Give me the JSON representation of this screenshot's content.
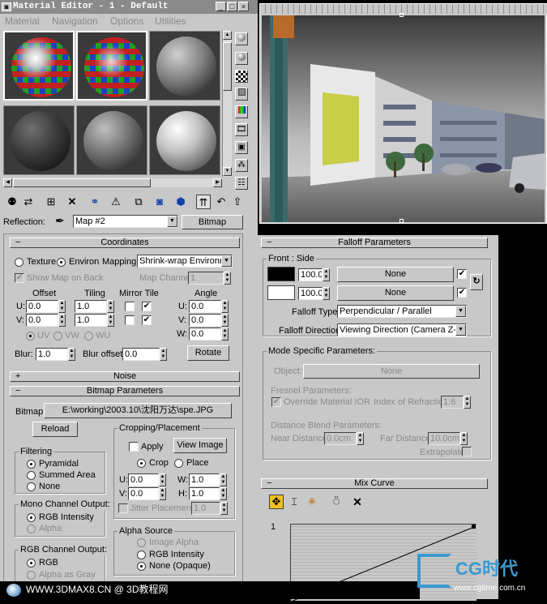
{
  "window": {
    "title": "Material Editor - 1 - Default",
    "title_buttons": [
      "_",
      "□",
      "×"
    ]
  },
  "menu": [
    "Material",
    "Navigation",
    "Options",
    "Utilities"
  ],
  "side_icons": [
    "sphere-icon",
    "sphere-lit-icon",
    "checker-icon",
    "square-icon",
    "gradient-icon",
    "film-icon",
    "monitor-icon",
    "tree-icon",
    "options-icon"
  ],
  "toolbar_icons": [
    "get-material-icon",
    "put-to-scene-icon",
    "assign-icon",
    "delete-icon",
    "make-unique-icon",
    "put-to-library-icon",
    "material-id-icon",
    "show-map-icon",
    "show-end-result-icon",
    "go-to-parent-icon",
    "go-forward-icon",
    "up-icon"
  ],
  "reflection": {
    "label": "Reflection:",
    "map_name": "Map #2",
    "type_button": "Bitmap"
  },
  "coordinates": {
    "title": "Coordinates",
    "texture_label": "Texture",
    "environ_label": "Environ",
    "mapping_label": "Mapping:",
    "mapping_value": "Shrink-wrap Environment",
    "show_map_label": "Show Map on Back",
    "map_channel_label": "Map Channel:",
    "map_channel_value": "1",
    "headers": {
      "offset": "Offset",
      "tiling": "Tiling",
      "mirror_tile": "Mirror Tile",
      "angle": "Angle"
    },
    "u_label": "U:",
    "v_label": "V:",
    "w_label": "W:",
    "u_offset": "0.0",
    "v_offset": "0.0",
    "u_tiling": "1.0",
    "v_tiling": "1.0",
    "u_angle": "0.0",
    "v_angle": "0.0",
    "w_angle": "0.0",
    "uv_label": "UV",
    "vw_label": "VW",
    "wu_label": "WU",
    "blur_label": "Blur:",
    "blur_value": "1.0",
    "blur_offset_label": "Blur offset:",
    "blur_offset_value": "0.0",
    "rotate_button": "Rotate"
  },
  "noise": {
    "title": "Noise"
  },
  "bitmap_params": {
    "title": "Bitmap Parameters",
    "bitmap_label": "Bitmap:",
    "bitmap_path": "E:\\working\\2003.10\\沈阳万达\\spe.JPG",
    "reload_button": "Reload",
    "cropping_title": "Cropping/Placement",
    "apply_label": "Apply",
    "view_image_button": "View Image",
    "crop_label": "Crop",
    "place_label": "Place",
    "u_label": "U:",
    "v_label": "V:",
    "w_label": "W:",
    "h_label": "H:",
    "u_value": "0.0",
    "v_value": "0.0",
    "w_value": "1.0",
    "h_value": "1.0",
    "jitter_label": "Jitter Placement:",
    "jitter_value": "1.0",
    "filtering_title": "Filtering",
    "filtering_options": [
      "Pyramidal",
      "Summed Area",
      "None"
    ],
    "mono_title": "Mono Channel Output:",
    "mono_options": [
      "RGB Intensity",
      "Alpha"
    ],
    "rgb_title": "RGB Channel Output:",
    "rgb_options": [
      "RGB",
      "Alpha as Gray"
    ],
    "alpha_title": "Alpha Source",
    "alpha_options": [
      "Image Alpha",
      "RGB Intensity",
      "None (Opaque)"
    ]
  },
  "falloff": {
    "title": "Falloff Parameters",
    "front_side_label": "Front : Side",
    "value1": "100.0",
    "value2": "100.0",
    "map1": "None",
    "map2": "None",
    "falloff_type_label": "Falloff Type:",
    "falloff_type_value": "Perpendicular / Parallel",
    "falloff_direction_label": "Falloff Direction:",
    "falloff_direction_value": "Viewing Direction (Camera Z-Axis)",
    "swap_icon": "swap-icon"
  },
  "mode_specific": {
    "title": "Mode Specific Parameters:",
    "object_label": "Object:",
    "object_value": "None",
    "fresnel_title": "Fresnel Parameters:",
    "override_label": "Override Material IOR",
    "ior_label": "Index of Refraction",
    "ior_value": "1.6",
    "distance_title": "Distance Blend Parameters:",
    "near_label": "Near Distance:",
    "near_value": "0.0cm",
    "far_label": "Far Distance:",
    "far_value": "10.0cm",
    "extrapolate_label": "Extrapolate"
  },
  "mix_curve": {
    "title": "Mix Curve",
    "y_label": "1",
    "tools": [
      "move-icon",
      "scale-point-icon",
      "add-point-icon",
      "reset-icon",
      "delete-point-icon"
    ]
  },
  "watermark": {
    "left_text": "WWW.3DMAX8.CN @ 3D教程网",
    "logo_text": "CG时代",
    "logo_url": "www.cgtime.com.cn"
  },
  "colors": {
    "panel": "#c8c8c8",
    "title_bar": "#8a8a8a",
    "black_swatch": "#000000",
    "white_swatch": "#ffffff",
    "building_yellow": "#d8dc40"
  }
}
